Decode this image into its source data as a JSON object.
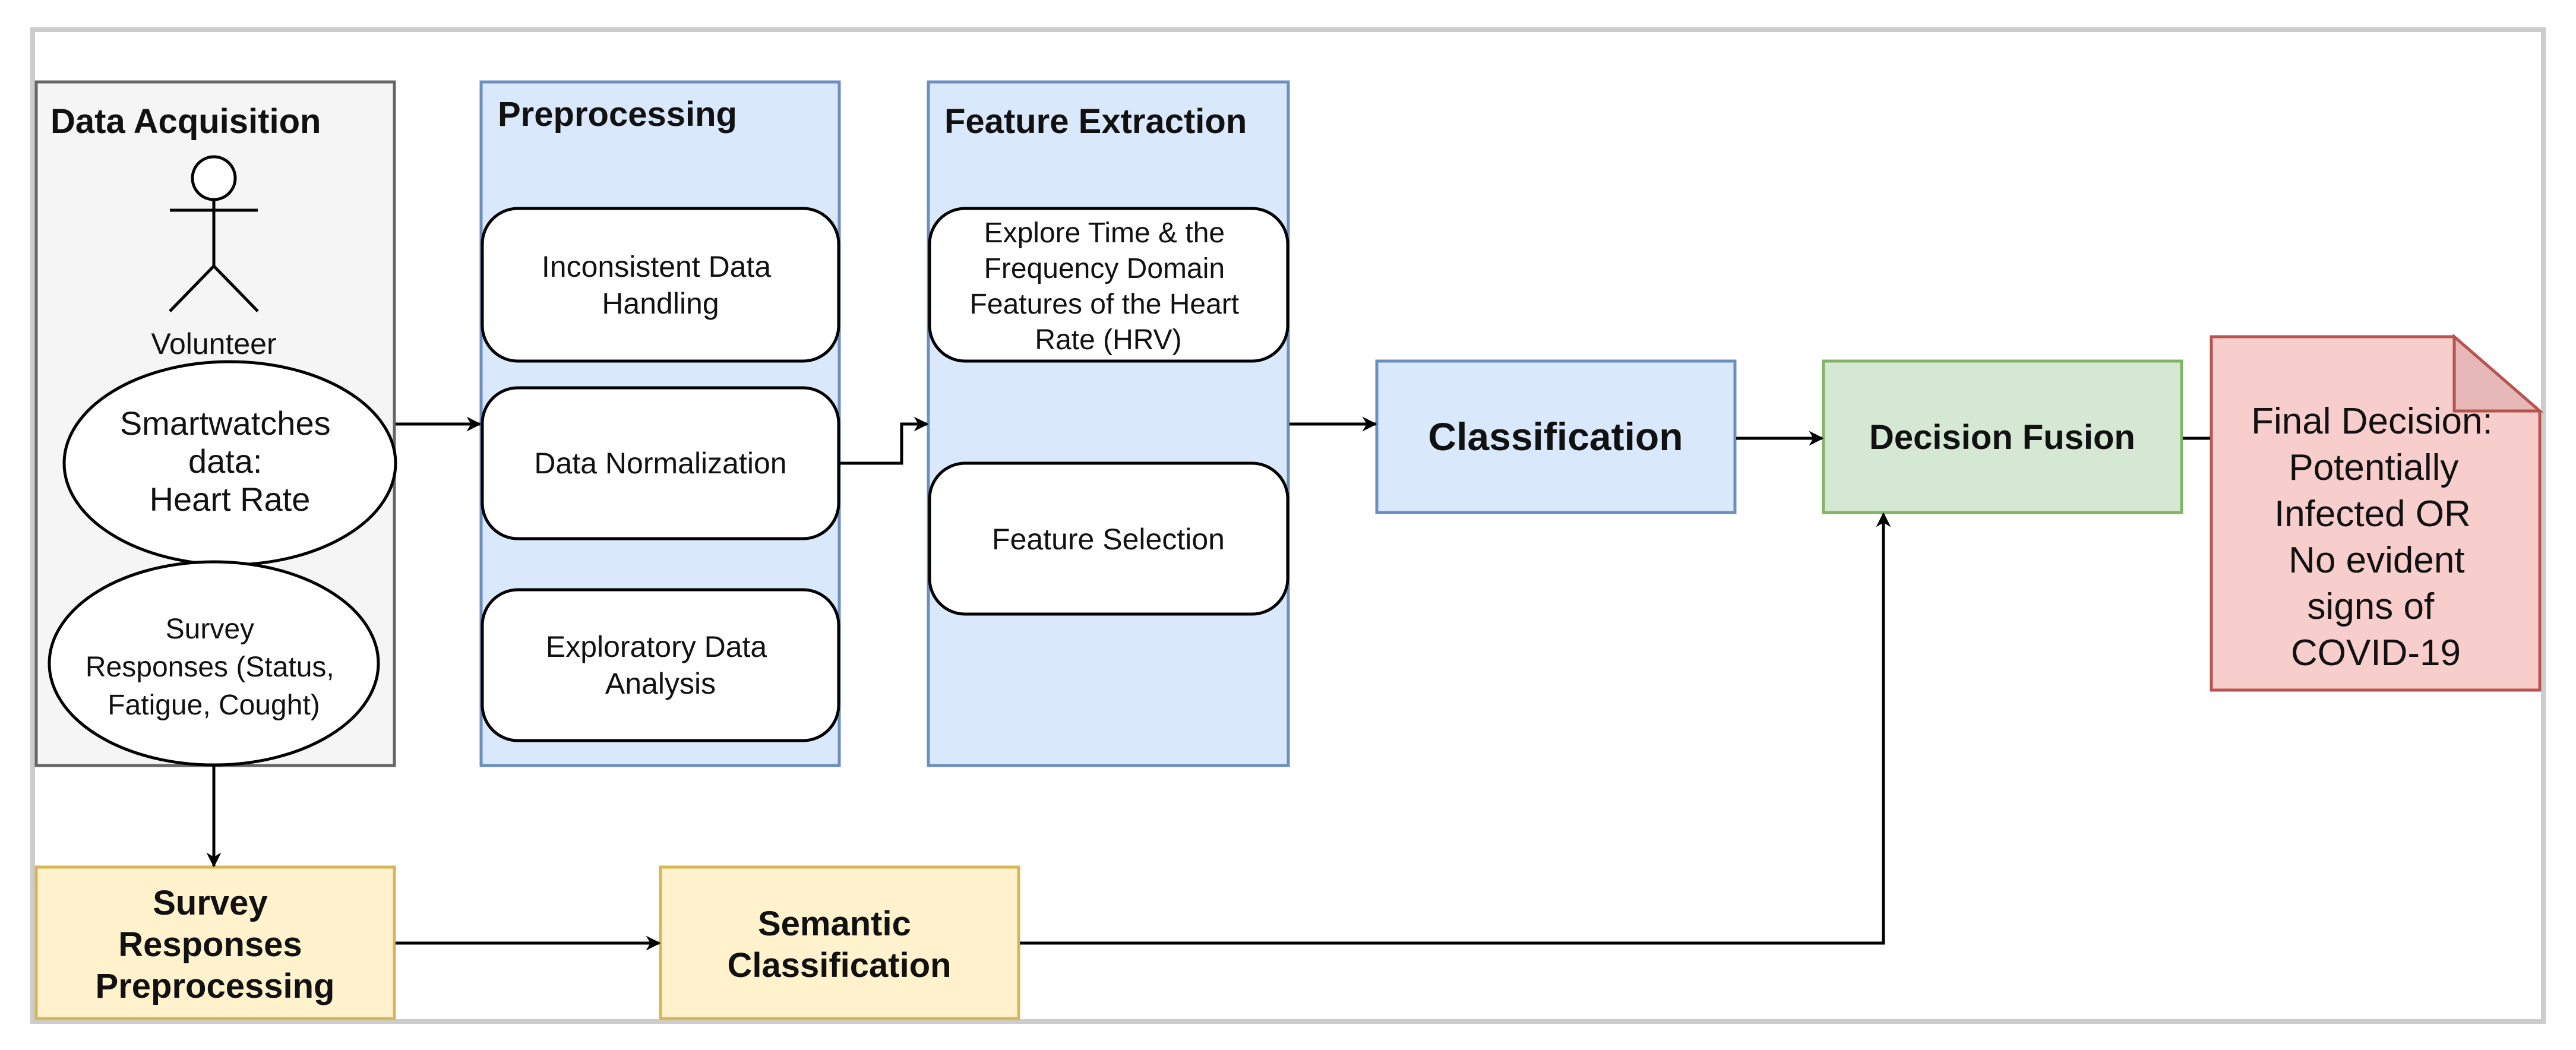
{
  "colors": {
    "gray_fill": "#f5f5f5",
    "gray_stroke": "#666666",
    "blue_fill": "#dae8fc",
    "blue_stroke": "#6c8ebf",
    "green_fill": "#d5e8d4",
    "green_stroke": "#82b366",
    "red_fill": "#f8cecc",
    "red_stroke": "#b85450",
    "yellow_fill": "#fff2cc",
    "yellow_stroke": "#d6b656",
    "frame": "#cccccc",
    "edge": "#000000"
  },
  "data_acquisition": {
    "title": "Data Acquisition",
    "actor_label": "Volunteer",
    "smartwatch": [
      "Smartwatches",
      "data:",
      "Heart Rate"
    ],
    "survey": [
      "Survey",
      "Responses (Status,",
      "Fatigue, Cought)"
    ]
  },
  "preprocessing": {
    "title": "Preprocessing",
    "steps": [
      [
        "Inconsistent Data",
        "Handling"
      ],
      [
        "Data Normalization"
      ],
      [
        "Exploratory Data",
        "Analysis"
      ]
    ]
  },
  "feature_extraction": {
    "title": "Feature Extraction",
    "steps": [
      [
        "Explore Time & the",
        "Frequency Domain",
        "Features of the Heart",
        "Rate (HRV)"
      ],
      [
        "Feature Selection"
      ]
    ]
  },
  "classification": {
    "label": "Classification"
  },
  "decision_fusion": {
    "label": "Decision Fusion"
  },
  "final_decision": {
    "lines": [
      "Final Decision:",
      "Potentially",
      "Infected OR",
      "No evident",
      "signs of",
      "COVID-19"
    ]
  },
  "survey_preprocessing": {
    "lines": [
      "Survey",
      "Responses",
      "Preprocessing"
    ]
  },
  "semantic_classification": {
    "lines": [
      "Semantic",
      "Classification"
    ]
  }
}
